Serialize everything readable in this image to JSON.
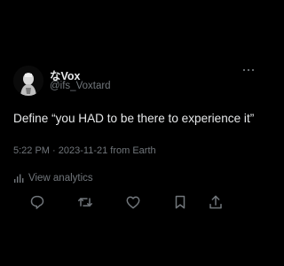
{
  "author": {
    "name_prefix_glyph": "な",
    "name": "Vox",
    "handle": "@ifs_Voxtard",
    "avatar_icon": "avatar-icon"
  },
  "tweet": {
    "text": "Define “you HAD to be there to experience it”"
  },
  "meta": {
    "time": "5:22 PM",
    "separator": "·",
    "date": "2023-11-21",
    "location": "from Earth"
  },
  "analytics": {
    "label": "View analytics",
    "icon": "analytics-bar-icon"
  },
  "actions": {
    "reply_icon": "reply-icon",
    "retweet_icon": "retweet-icon",
    "like_icon": "heart-icon",
    "bookmark_icon": "bookmark-icon",
    "share_icon": "share-icon"
  },
  "menu": {
    "icon": "more-dots-icon"
  },
  "colors": {
    "background": "#000000",
    "primary_text": "#e7e9ea",
    "secondary_text": "#71767b"
  }
}
